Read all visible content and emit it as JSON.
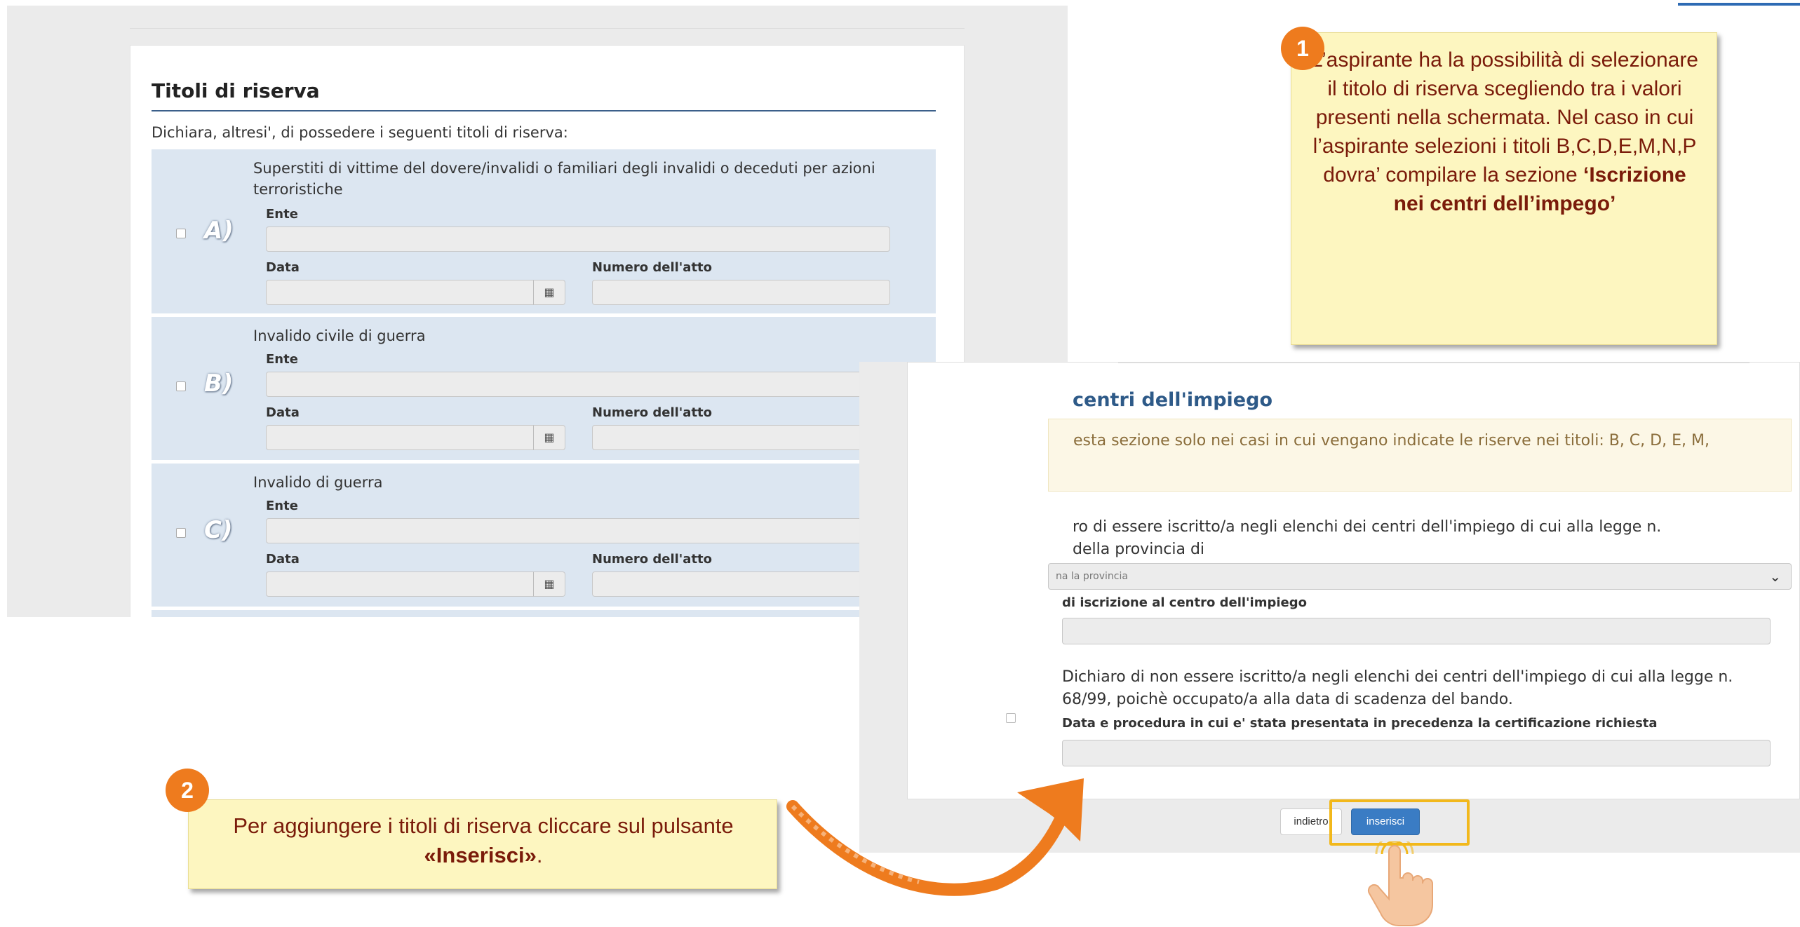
{
  "left_panel": {
    "title": "Titoli di riserva",
    "intro": "Dichiara, altresi', di possedere i seguenti titoli di riserva:",
    "ente_label": "Ente",
    "data_label": "Data",
    "numero_label": "Numero dell'atto",
    "calendar_glyph": "▦",
    "rows": [
      {
        "letter": "A)",
        "desc": "Superstiti di vittime del dovere/invalidi o familiari degli invalidi o deceduti per azioni terroristiche"
      },
      {
        "letter": "B)",
        "desc": "Invalido civile di guerra"
      },
      {
        "letter": "C)",
        "desc": "Invalido di guerra"
      }
    ]
  },
  "callout1": {
    "badge": "1",
    "text_plain": "L’aspirante ha la possibilità di selezionare il titolo di riserva scegliendo tra i valori presenti nella schermata. Nel caso in cui l’aspirante selezioni i titoli B,C,D,E,M,N,P dovra’ compilare la sezione ",
    "text_bold": "‘Iscrizione nei centri dell’impego’"
  },
  "right_panel": {
    "title": "centri dell'impiego",
    "warning": "esta sezione solo nei casi in cui vengano indicate le riserve nei titoli: B, C, D, E, M,",
    "option1_line1": "ro di essere iscritto/a negli elenchi dei centri dell'impiego di cui alla legge n.",
    "option1_line2": "della provincia di",
    "province_placeholder": "na la provincia",
    "iscrizione_label": "di iscrizione al centro dell'impiego",
    "option2_line1": "Dichiaro di non essere iscritto/a negli elenchi dei centri dell'impiego di cui alla legge n.",
    "option2_line2": "68/99, poichè occupato/a alla data di scadenza del bando.",
    "certificazione_label": "Data e procedura in cui e' stata presentata in precedenza la certificazione richiesta",
    "back_button": "indietro",
    "insert_button": "inserisci"
  },
  "callout2": {
    "badge": "2",
    "text_plain": "Per aggiungere i titoli di riserva cliccare sul pulsante ",
    "text_bold": "«Inserisci»",
    "text_end": "."
  },
  "colors": {
    "badge": "#ee7b1e",
    "callout_bg": "#fdf6c0",
    "callout_text": "#7a1b0a",
    "row_bg": "#dce6f1",
    "highlight": "#f2b81b",
    "primary_button": "#3a7cc4"
  },
  "icons": [
    "calendar-icon",
    "chevron-down-icon",
    "curved-arrow-icon",
    "pointing-hand-icon"
  ]
}
